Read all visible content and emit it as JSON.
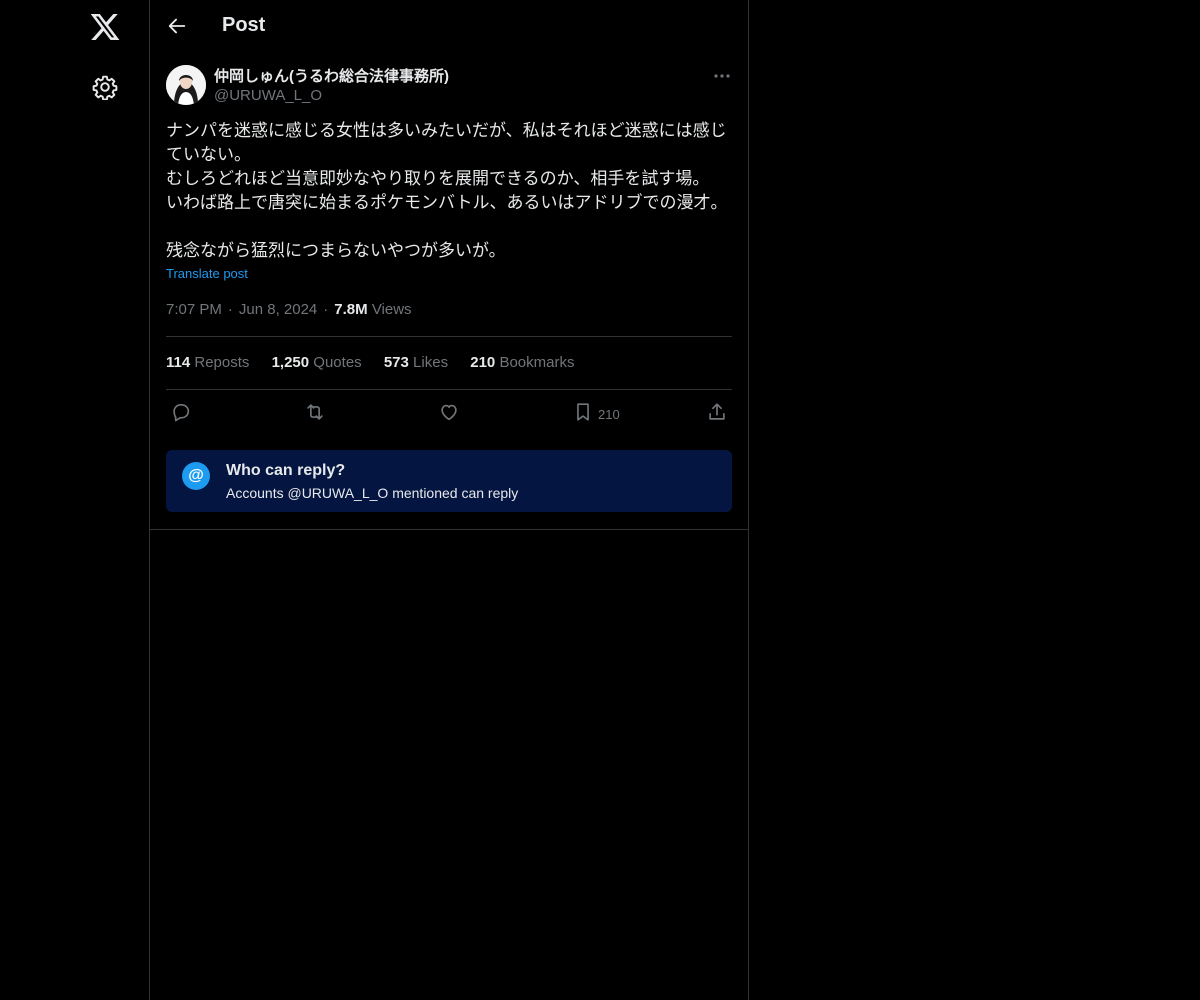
{
  "nav": {
    "logo_icon": "x-logo-icon",
    "settings_icon": "gear-icon"
  },
  "header": {
    "back_icon": "arrow-left-icon",
    "title": "Post"
  },
  "post": {
    "author_name": "仲岡しゅん(うるわ総合法律事務所)",
    "author_handle": "@URUWA_L_O",
    "text_lines": [
      "ナンパを迷惑に感じる女性は多いみたいだが、私はそれほど迷惑には感じ",
      "ていない。",
      "むしろどれほど当意即妙なやり取りを展開できるのか、相手を試す場。",
      "いわば路上で唐突に始まるポケモンバトル、あるいはアドリブでの漫才。",
      "",
      "残念ながら猛烈につまらないやつが多いが。"
    ],
    "translate_label": "Translate post",
    "time": "7:07 PM",
    "date": "Jun 8, 2024",
    "views_count": "7.8M",
    "views_label": "Views",
    "separator": "·"
  },
  "stats": {
    "reposts_count": "114",
    "reposts_label": "Reposts",
    "quotes_count": "1,250",
    "quotes_label": "Quotes",
    "likes_count": "573",
    "likes_label": "Likes",
    "bookmarks_count": "210",
    "bookmarks_label": "Bookmarks"
  },
  "actions": {
    "bookmark_count": "210"
  },
  "reply_restriction": {
    "icon_glyph": "@",
    "title": "Who can reply?",
    "subtitle": "Accounts @URUWA_L_O mentioned can reply"
  },
  "colors": {
    "background": "#000000",
    "text": "#e7e9ea",
    "muted": "#71767b",
    "accent": "#1d9bf0",
    "border": "#2f3336",
    "reply_box": "#031540"
  }
}
